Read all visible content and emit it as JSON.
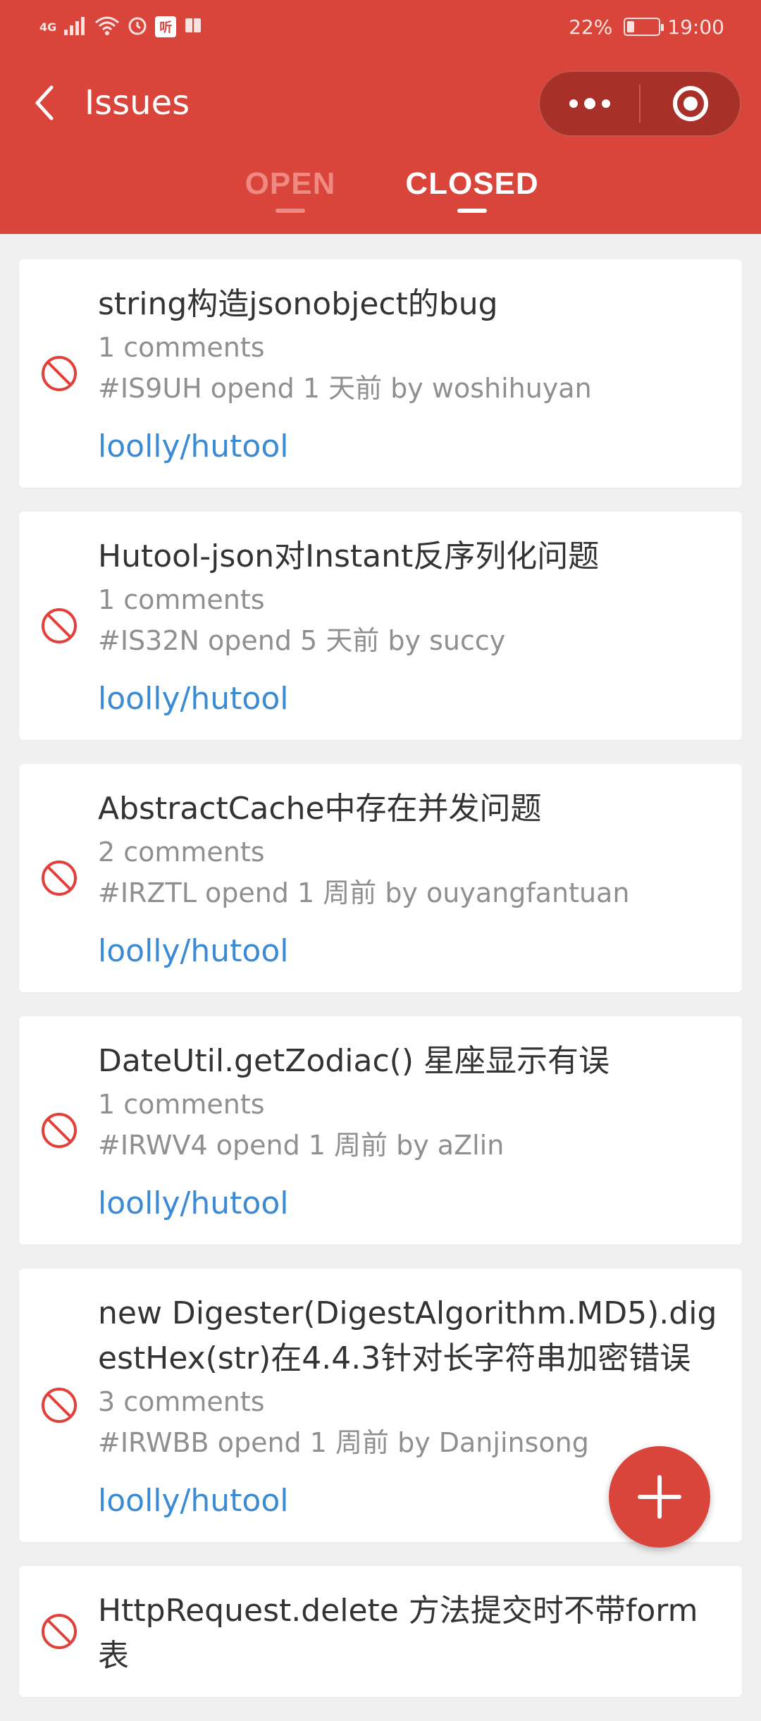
{
  "status_bar": {
    "network": "4G",
    "icons": [
      "signal-icon",
      "wifi-icon",
      "alarm-icon",
      "app-badge-icon",
      "book-icon"
    ],
    "app_badge": "听",
    "battery_percent": "22%",
    "battery_level": 0.22,
    "time": "19:00"
  },
  "nav": {
    "title": "Issues",
    "back_icon": "chevron-left-icon",
    "more_icon": "more-dots-icon",
    "target_icon": "target-icon"
  },
  "tabs": [
    {
      "label": "OPEN",
      "active": false
    },
    {
      "label": "CLOSED",
      "active": true
    }
  ],
  "colors": {
    "brand": "#d9453b",
    "link": "#3a8ad4",
    "closed_icon": "#e0413a",
    "muted_text": "#8f8f8f"
  },
  "issues": [
    {
      "title": "string构造jsonobject的bug",
      "comments": "1 comments",
      "meta": "#IS9UH opend 1 天前 by woshihuyan",
      "repo": "loolly/hutool"
    },
    {
      "title": "Hutool-json对Instant反序列化问题",
      "comments": "1 comments",
      "meta": "#IS32N opend 5 天前 by succy",
      "repo": "loolly/hutool"
    },
    {
      "title": "AbstractCache中存在并发问题",
      "comments": "2 comments",
      "meta": "#IRZTL opend 1 周前 by ouyangfantuan",
      "repo": "loolly/hutool"
    },
    {
      "title": "DateUtil.getZodiac() 星座显示有误",
      "comments": "1 comments",
      "meta": "#IRWV4 opend 1 周前 by aZlin",
      "repo": "loolly/hutool"
    },
    {
      "title": "new Digester(DigestAlgorithm.MD5).digestHex(str)在4.4.3针对长字符串加密错误",
      "comments": "3 comments",
      "meta": "#IRWBB opend 1 周前 by Danjinsong",
      "repo": "loolly/hutool"
    },
    {
      "title": "HttpRequest.delete 方法提交时不带form表",
      "comments": "",
      "meta": "",
      "repo": ""
    }
  ],
  "fab": {
    "icon": "plus-icon"
  }
}
